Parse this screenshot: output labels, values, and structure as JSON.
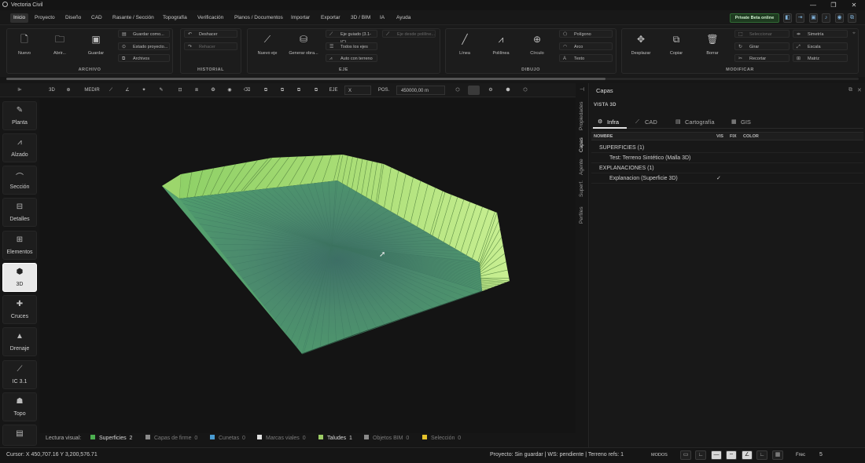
{
  "app": {
    "title": "Vectoria Civil"
  },
  "window_controls": {
    "minimize": "—",
    "maximize": "❐",
    "close": "✕"
  },
  "menu": {
    "items": [
      "Inicio",
      "Proyecto",
      "Diseño",
      "CAD",
      "Rasante / Sección",
      "Topografía",
      "Verificación",
      "Planos / Documentos",
      "Importar",
      "Exportar",
      "3D / BIM",
      "IA",
      "Ayuda"
    ],
    "active": "Inicio"
  },
  "beta_badge": "Private Beta online",
  "ribbon": {
    "archivo": {
      "label": "ARCHIVO",
      "nuevo": "Nuevo",
      "abrir": "Abrir...",
      "guardar": "Guardar",
      "guardar_como": "Guardar como...",
      "estado": "Estado proyecto...",
      "archivos": "Archivos"
    },
    "historial": {
      "label": "HISTORIAL",
      "deshacer": "Deshacer",
      "rehacer": "Rehacer"
    },
    "eje": {
      "label": "EJE",
      "nuevo_eje": "Nuevo eje",
      "generar": "Generar obra...",
      "eje_guiado": "Eje guiado (3.1-IC)",
      "eje_polilinea": "Eje desde polilíne...",
      "todos_ejes": "Todos los ejes",
      "auto_terreno": "Auto con terreno"
    },
    "dibujo": {
      "label": "DIBUJO",
      "linea": "Línea",
      "polilinea": "Polilínea",
      "circulo": "Círculo",
      "poligono": "Polígono",
      "arco": "Arco",
      "texto": "Texto"
    },
    "modificar": {
      "label": "MODIFICAR",
      "desplazar": "Desplazar",
      "copiar": "Copiar",
      "borrar": "Borrar",
      "seleccionar": "Seleccionar",
      "girar": "Girar",
      "recortar": "Recortar",
      "simetria": "Simetría",
      "escala": "Escala",
      "matriz": "Matriz"
    }
  },
  "viewtools": {
    "mode": "3D",
    "medir": "MEDIR",
    "eje": "EJE",
    "eje_value": "X",
    "pos": "POS.",
    "pos_value": "450000,00 m"
  },
  "sidebar": {
    "items": [
      "Planta",
      "Alzado",
      "Sección",
      "Detalles",
      "Elementos",
      "3D",
      "Cruces",
      "Drenaje",
      "IC 3.1",
      "Topo"
    ],
    "active": "3D"
  },
  "legend": {
    "title": "Lectura visual:",
    "items": [
      {
        "name": "Superficies",
        "count": "2",
        "color": "#4caf50",
        "active": true
      },
      {
        "name": "Capas de firme",
        "count": "0",
        "color": "#8a8a8a",
        "active": false
      },
      {
        "name": "Cunetas",
        "count": "0",
        "color": "#4a9bd1",
        "active": false
      },
      {
        "name": "Marcas viales",
        "count": "0",
        "color": "#e0e0e0",
        "active": false
      },
      {
        "name": "Taludes",
        "count": "1",
        "color": "#9ccc65",
        "active": true
      },
      {
        "name": "Objetos BIM",
        "count": "0",
        "color": "#8a8a8a",
        "active": false
      },
      {
        "name": "Selección",
        "count": "0",
        "color": "#e5c22b",
        "active": false
      }
    ]
  },
  "status": {
    "cursor": "Cursor: X 450,707.16  Y 3,200,576.71",
    "project": "Proyecto: Sin guardar | WS: pendiente | Terreno refs: 1",
    "modos": "MODOS",
    "frec": "Frec",
    "frec_value": "5"
  },
  "panel": {
    "title": "Capas",
    "subtitle": "VISTA 3D",
    "vtabs": [
      "Propiedades",
      "Capas",
      "Agente",
      "Superf.",
      "Perfiles"
    ],
    "active_vtab": "Capas",
    "tabs": [
      "Infra",
      "CAD",
      "Cartografía",
      "GIS"
    ],
    "active_tab": "Infra",
    "columns": [
      "NOMBRE",
      "VIS",
      "FIX",
      "COLOR"
    ],
    "rows": [
      {
        "name": "SUPERFICIES (1)",
        "group": true,
        "vis": ""
      },
      {
        "name": "Test: Terreno Sintético (Malla 3D)",
        "group": false,
        "vis": ""
      },
      {
        "name": "EXPLANACIONES (1)",
        "group": true,
        "vis": ""
      },
      {
        "name": "Explanacion (Superficie 3D)",
        "group": false,
        "vis": "✓"
      }
    ]
  }
}
